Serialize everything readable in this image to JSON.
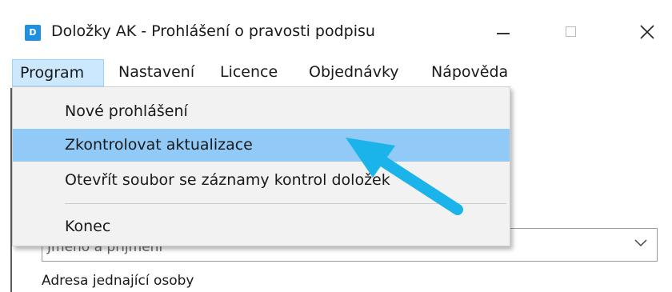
{
  "window": {
    "icon_letter": "D",
    "title": "Doložky AK - Prohlášení o pravosti podpisu"
  },
  "menubar": {
    "items": [
      {
        "label": "Program",
        "active": true
      },
      {
        "label": "Nastavení"
      },
      {
        "label": "Licence"
      },
      {
        "label": "Objednávky"
      },
      {
        "label": "Nápověda"
      }
    ]
  },
  "program_menu": {
    "items": [
      {
        "label": "Nové prohlášení"
      },
      {
        "label": "Zkontrolovat aktualizace",
        "highlighted": true
      },
      {
        "label": "Otevřít soubor se záznamy kontrol doložek"
      },
      {
        "label": "Konec"
      }
    ]
  },
  "form": {
    "combo_value": "Jméno a příjmení",
    "address_label": "Adresa jednající osoby"
  },
  "colors": {
    "highlight": "#91c9f7",
    "menu_active": "#cce8ff",
    "arrow": "#1ab4ea",
    "icon": "#1f8fe0"
  },
  "icons": {
    "app": "app-icon",
    "minimize": "minimize-icon",
    "maximize": "maximize-icon",
    "close": "close-icon",
    "combo": "chevron-down-icon",
    "annotation": "pointer-arrow-icon"
  }
}
